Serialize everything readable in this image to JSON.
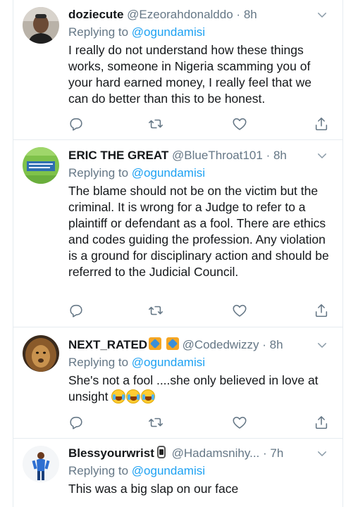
{
  "tweets": [
    {
      "name": "doziecute",
      "handle": "@Ezeorahdonalddo",
      "separator": "·",
      "time": "8h",
      "replying_label": "Replying to",
      "replying_to": "@ogundamisi",
      "text": "I really do not understand how these things works,  someone in Nigeria scamming you of your hard earned money, I really feel that we can do better than this to be honest."
    },
    {
      "name": "ERIC THE GREAT",
      "handle": "@BlueThroat101",
      "separator": "·",
      "time": "8h",
      "replying_label": "Replying to",
      "replying_to": "@ogundamisi",
      "text": "The blame should not be on the victim but the criminal. It is wrong for a Judge to refer to a plaintiff or defendant as a fool. There are ethics and codes guiding the profession. Any violation is a ground for disciplinary action and should be referred to the Judicial Council."
    },
    {
      "name": "NEXT_RATED",
      "handle": "@Codedwizzy",
      "separator": "·",
      "time": "8h",
      "replying_label": "Replying to",
      "replying_to": "@ogundamisi",
      "text": "She's not a fool ....she only believed in love at unsight"
    },
    {
      "name": "Blessyourwrist",
      "handle": "@Hadamsnihy...",
      "separator": "·",
      "time": "7h",
      "replying_label": "Replying to",
      "replying_to": "@ogundamisi",
      "text": "This was a big slap on our face"
    }
  ],
  "icons": {
    "reply": "reply-icon",
    "retweet": "retweet-icon",
    "like": "heart-icon",
    "share": "share-icon",
    "caret": "chevron-down-icon"
  },
  "colors": {
    "text": "#14171a",
    "secondary": "#657786",
    "link": "#1da1f2",
    "divider": "#e6ecf0"
  }
}
